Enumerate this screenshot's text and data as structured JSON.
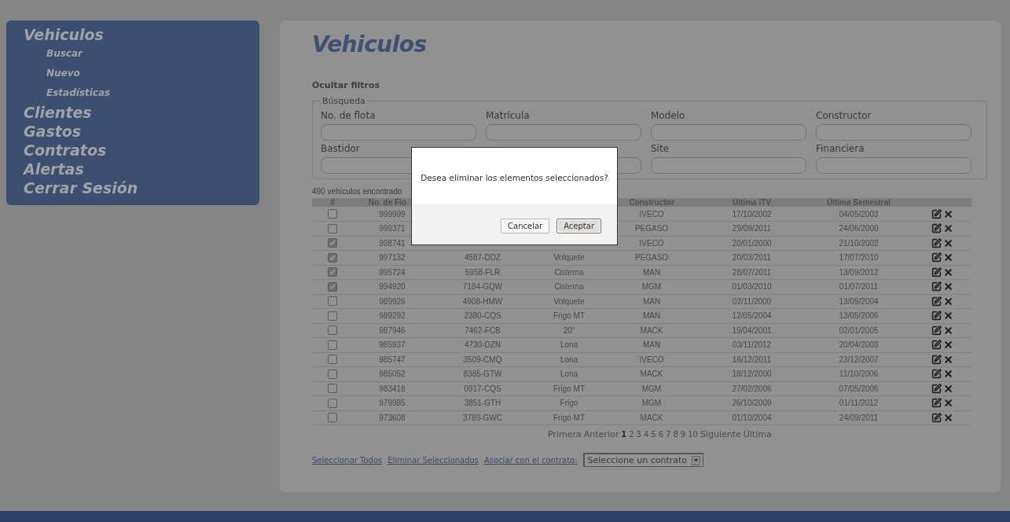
{
  "sidebar": {
    "items": [
      {
        "label": "Vehiculos",
        "children": [
          {
            "label": "Buscar"
          },
          {
            "label": "Nuevo"
          },
          {
            "label": "Estadísticas"
          }
        ]
      },
      {
        "label": "Clientes"
      },
      {
        "label": "Gastos"
      },
      {
        "label": "Contratos"
      },
      {
        "label": "Alertas"
      },
      {
        "label": "Cerrar Sesión"
      }
    ]
  },
  "title": "Vehiculos",
  "filters_toggle": "Ocultar filtros",
  "filters": {
    "legend": "Búsqueda",
    "fields": [
      {
        "kind": "text",
        "label": "No. de flota"
      },
      {
        "kind": "text",
        "label": "Matrícula"
      },
      {
        "kind": "text",
        "label": "Modelo"
      },
      {
        "kind": "text",
        "label": "Constructor"
      },
      {
        "kind": "text",
        "label": "Bastidor"
      },
      {
        "kind": "covered"
      },
      {
        "kind": "text",
        "label": "Site"
      },
      {
        "kind": "text",
        "label": "Financiera"
      }
    ]
  },
  "results_count": "490 vehículos encontrado",
  "table": {
    "select_header": "#",
    "columns": [
      {
        "label": "No. de Flo"
      },
      {},
      {},
      {
        "label": "Constructor"
      },
      {
        "label": "Última ITV"
      },
      {
        "label": "Última Semestral"
      },
      {}
    ],
    "rows": [
      {
        "selected": false,
        "cells": [
          "999999",
          null,
          null,
          "IVECO",
          "17/10/2002",
          "04/05/2003"
        ]
      },
      {
        "selected": false,
        "cells": [
          "999371",
          null,
          null,
          "PEGASO",
          "29/09/2011",
          "24/06/2000"
        ]
      },
      {
        "selected": true,
        "cells": [
          "998741",
          null,
          null,
          "IVECO",
          "20/01/2000",
          "21/10/2002"
        ]
      },
      {
        "selected": true,
        "cells": [
          "997132",
          "4587-DDZ",
          "Volquete",
          "PEGASO",
          "20/03/2011",
          "17/07/2010"
        ]
      },
      {
        "selected": true,
        "cells": [
          "995724",
          "5958-FLR",
          "Cisterna",
          "MAN",
          "28/07/2011",
          "13/09/2012"
        ]
      },
      {
        "selected": true,
        "cells": [
          "994920",
          "7184-GQW",
          "Cisterna",
          "MGM",
          "01/03/2010",
          "01/07/2011"
        ]
      },
      {
        "selected": false,
        "cells": [
          "989926",
          "4908-HMW",
          "Volquete",
          "MAN",
          "02/11/2000",
          "13/05/2004"
        ]
      },
      {
        "selected": false,
        "cells": [
          "989292",
          "2380-CQS",
          "Frigo MT",
          "MAN",
          "12/05/2004",
          "13/05/2006"
        ]
      },
      {
        "selected": false,
        "cells": [
          "987946",
          "7462-FCB",
          "20\"",
          "MACK",
          "19/04/2001",
          "02/01/2005"
        ]
      },
      {
        "selected": false,
        "cells": [
          "985937",
          "4730-DZN",
          "Lona",
          "MAN",
          "03/11/2012",
          "20/04/2003"
        ]
      },
      {
        "selected": false,
        "cells": [
          "985747",
          "3509-CMQ",
          "Lona",
          "IVECO",
          "16/12/2011",
          "23/12/2007"
        ]
      },
      {
        "selected": false,
        "cells": [
          "985052",
          "8385-GTW",
          "Lona",
          "MACK",
          "18/12/2000",
          "11/10/2006"
        ]
      },
      {
        "selected": false,
        "cells": [
          "983418",
          "0917-CQS",
          "Frigo MT",
          "MGM",
          "27/02/2006",
          "07/05/2006"
        ]
      },
      {
        "selected": false,
        "cells": [
          "979985",
          "3851-GTH",
          "Frigo",
          "MGM",
          "26/10/2009",
          "01/11/2012"
        ]
      },
      {
        "selected": false,
        "cells": [
          "973608",
          "3789-GWC",
          "Frigo MT",
          "MACK",
          "01/10/2004",
          "24/09/2011"
        ]
      }
    ]
  },
  "pagination": {
    "first": "Primera",
    "previous": "Anterior",
    "pages": [
      {
        "label": "1",
        "selected": true
      },
      {
        "label": "2",
        "selected": false
      },
      {
        "label": "3",
        "selected": false
      },
      {
        "label": "4",
        "selected": false
      },
      {
        "label": "5",
        "selected": false
      },
      {
        "label": "6",
        "selected": false
      },
      {
        "label": "7",
        "selected": false
      },
      {
        "label": "8",
        "selected": false
      },
      {
        "label": "9",
        "selected": false
      },
      {
        "label": "10",
        "selected": false
      }
    ],
    "next": "Siguiente",
    "last": "Última"
  },
  "actions": {
    "links": [
      "Seleccionar Todos",
      "Eliminar Seleccionados",
      "Asociar con el contrato:"
    ],
    "contract_select": {
      "value": "Seleccione un contrato"
    }
  },
  "dialog": {
    "message": "Desea eliminar los elementos seleccionados?",
    "buttons": [
      {
        "label": "Cancelar",
        "focused": false
      },
      {
        "label": "Aceptar",
        "focused": true
      }
    ]
  }
}
